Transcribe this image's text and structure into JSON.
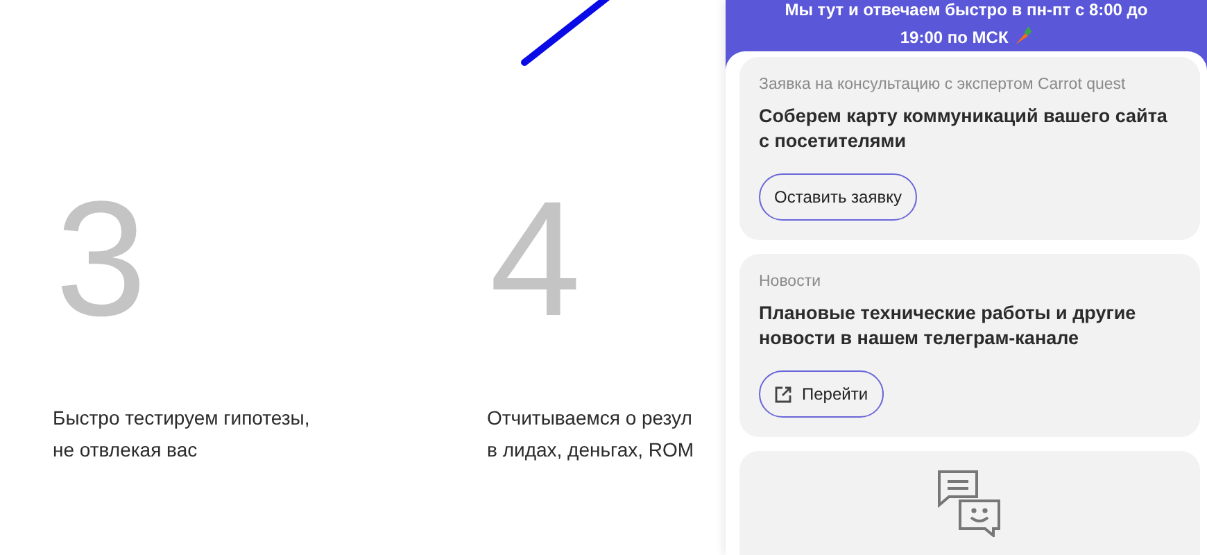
{
  "steps": [
    {
      "number": "3",
      "lines": [
        "Быстро тестируем гипотезы,",
        "не отвлекая вас"
      ]
    },
    {
      "number": "4",
      "lines": [
        "Отчитываемся о резул",
        "в лидах, деньгах, ROM"
      ]
    }
  ],
  "chat_panel": {
    "header_text": "Мы тут и отвечаем быстро в пн-пт с 8:00 до 19:00 по МСК",
    "cards": [
      {
        "kind": "action",
        "caption": "Заявка на консультацию с экспертом Carrot quest",
        "title": "Соберем карту коммуникаций вашего сайта с посетителями",
        "button": {
          "label": "Оставить заявку",
          "external": false
        }
      },
      {
        "kind": "action",
        "caption": "Новости",
        "title": "Плановые технические работы и другие новости в нашем телеграм-канале",
        "button": {
          "label": "Перейти",
          "external": true
        }
      },
      {
        "kind": "chat"
      }
    ]
  }
}
